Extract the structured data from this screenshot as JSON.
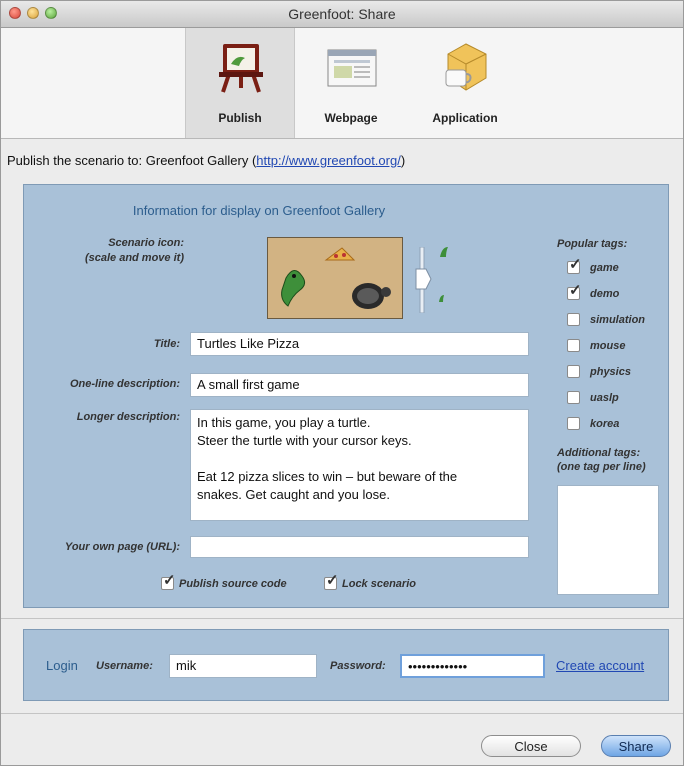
{
  "window": {
    "title": "Greenfoot: Share"
  },
  "tabs": [
    {
      "label": "Publish",
      "icon": "easel-icon",
      "selected": true
    },
    {
      "label": "Webpage",
      "icon": "webpage-icon",
      "selected": false
    },
    {
      "label": "Application",
      "icon": "application-box-icon",
      "selected": false
    }
  ],
  "publish": {
    "prefix": "Publish the scenario to: Greenfoot Gallery (",
    "link": "http://www.greenfoot.org/",
    "suffix": ")"
  },
  "info": {
    "heading": "Information for display on Greenfoot Gallery",
    "icon_label_1": "Scenario icon:",
    "icon_label_2": "(scale and move it)",
    "title_label": "Title:",
    "title_value": "Turtles Like Pizza",
    "oneline_label": "One-line description:",
    "oneline_value": "A small first game",
    "longer_label": "Longer description:",
    "longer_line1": "In this game, you play a turtle.",
    "longer_line2": "Steer the turtle with your cursor keys.",
    "longer_line3": "Eat 12 pizza slices to win – but beware of the",
    "longer_line4": "snakes. Get caught and you lose.",
    "url_label": "Your own page (URL):",
    "url_value": "",
    "publish_source": "Publish source code",
    "lock_scenario": "Lock scenario"
  },
  "tags": {
    "heading": "Popular tags:",
    "items": [
      {
        "label": "game",
        "checked": true
      },
      {
        "label": "demo",
        "checked": true
      },
      {
        "label": "simulation",
        "checked": false
      },
      {
        "label": "mouse",
        "checked": false
      },
      {
        "label": "physics",
        "checked": false
      },
      {
        "label": "uaslp",
        "checked": false
      },
      {
        "label": "korea",
        "checked": false
      }
    ],
    "additional_1": "Additional tags:",
    "additional_2": "(one tag per line)"
  },
  "login": {
    "label": "Login",
    "username_label": "Username:",
    "username_value": "mik",
    "password_label": "Password:",
    "password_value": "•••••••••••••",
    "create_account": "Create account"
  },
  "buttons": {
    "close": "Close",
    "share": "Share"
  },
  "colors": {
    "panel": "#a9c1d8",
    "link": "#2148b3",
    "accent": "#6fa5e4"
  }
}
